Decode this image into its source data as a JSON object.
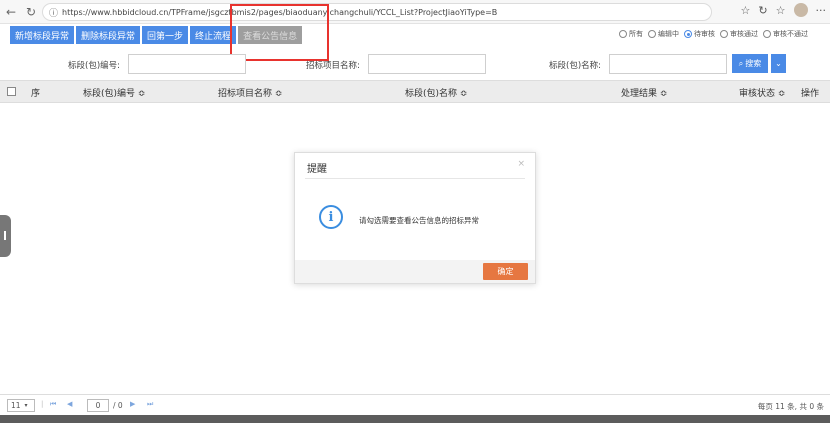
{
  "browser": {
    "url": "https://www.hbbidcloud.cn/TPFrame/jsgcztbmis2/pages/biaoduanyichangchuli/YCCL_List?ProjectJiaoYiType=B"
  },
  "toolbar": {
    "buttons": [
      "新增标段异常",
      "删除标段异常",
      "回第一步",
      "终止流程",
      "查看公告信息"
    ],
    "filters": [
      "所有",
      "编辑中",
      "待审核",
      "审核通过",
      "审核不通过"
    ],
    "selected_filter": "待审核"
  },
  "search": {
    "label_code": "标段(包)编号:",
    "label_project": "招标项目名称:",
    "label_name": "标段(包)名称:",
    "button": "搜索"
  },
  "table": {
    "columns": [
      "序",
      "标段(包)编号 ≎",
      "招标项目名称 ≎",
      "标段(包)名称 ≎",
      "处理结果 ≎",
      "审核状态 ≎",
      "操作"
    ]
  },
  "modal": {
    "title": "提醒",
    "close": "×",
    "icon_glyph": "i",
    "message": "请勾选需要查看公告信息的招标异常",
    "ok": "确定"
  },
  "pager": {
    "page_size": "11",
    "page": "0",
    "total_pages": "/ 0",
    "summary": "每页 11 条, 共 0 条"
  },
  "icons": {
    "back": "back-arrow-icon",
    "refresh": "refresh-icon",
    "lock": "lock-icon",
    "info": "info-icon"
  }
}
